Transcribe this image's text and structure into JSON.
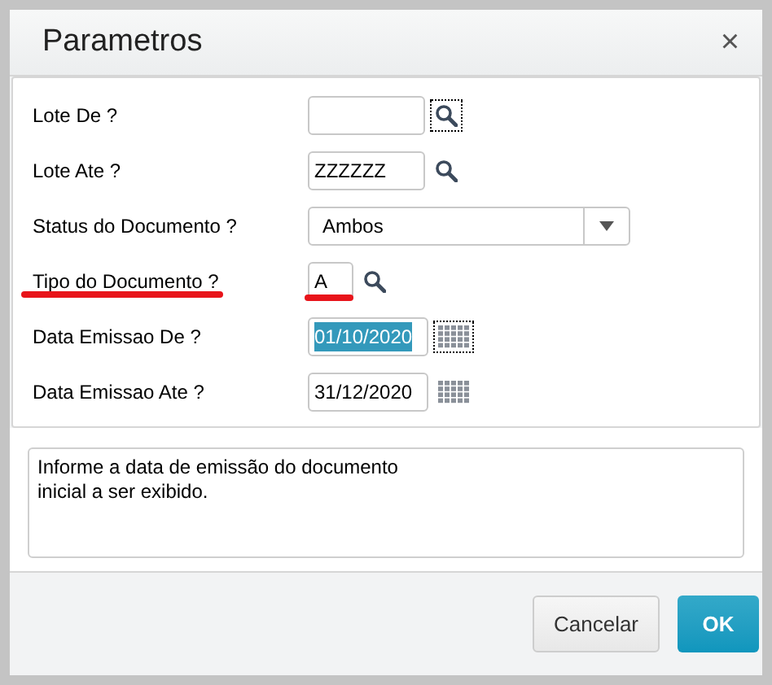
{
  "dialog": {
    "title": "Parametros",
    "close": "×"
  },
  "fields": [
    {
      "label": "Lote De ?",
      "kind": "lookup",
      "highlighted": false,
      "icon_focused": true
    },
    {
      "label": "Lote Ate ?",
      "kind": "lookup",
      "value": "ZZZZZZ",
      "highlighted": false,
      "icon_focused": false,
      "value_selected": false
    },
    {
      "label": "Status do Documento ?",
      "kind": "select",
      "value": "Ambos",
      "highlighted": false
    },
    {
      "label": "Tipo do Documento ?",
      "kind": "code",
      "value": "A",
      "highlighted": true,
      "icon_focused": false,
      "value_selected": false
    },
    {
      "label": "Data Emissao De ?",
      "kind": "date",
      "value": "01/10/2020",
      "highlighted": false,
      "icon_focused": true,
      "value_selected": true
    },
    {
      "label": "Data Emissao Ate ?",
      "kind": "date",
      "value": "31/12/2020",
      "highlighted": false,
      "icon_focused": false,
      "value_selected": false
    }
  ],
  "help": {
    "lines": [
      "Informe a data de emissão do documento",
      "inicial a ser exibido."
    ]
  },
  "buttons": [
    {
      "label": "Cancelar",
      "kind": "secondary"
    },
    {
      "label": "OK",
      "kind": "primary"
    }
  ]
}
